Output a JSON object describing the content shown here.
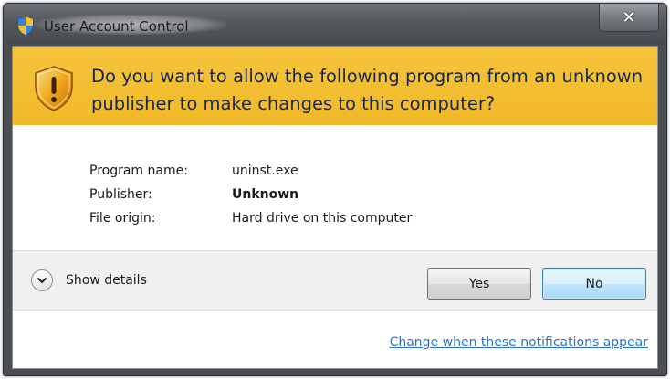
{
  "window": {
    "title": "User Account Control",
    "close_symbol": "✕",
    "close_icon": "close-icon",
    "title_icon": "uac-shield-icon"
  },
  "banner": {
    "question": "Do you want to allow the following program from an unknown publisher to make changes to this computer?",
    "icon": "warning-shield-icon",
    "color": "#f3bf33"
  },
  "details": {
    "program_name_label": "Program name:",
    "program_name_value": "uninst.exe",
    "publisher_label": "Publisher:",
    "publisher_value": "Unknown",
    "file_origin_label": "File origin:",
    "file_origin_value": "Hard drive on this computer"
  },
  "footer": {
    "show_details_label": "Show details",
    "show_details_icon": "chevron-down-icon",
    "yes_label": "Yes",
    "no_label": "No",
    "change_link": "Change when these notifications appear"
  }
}
